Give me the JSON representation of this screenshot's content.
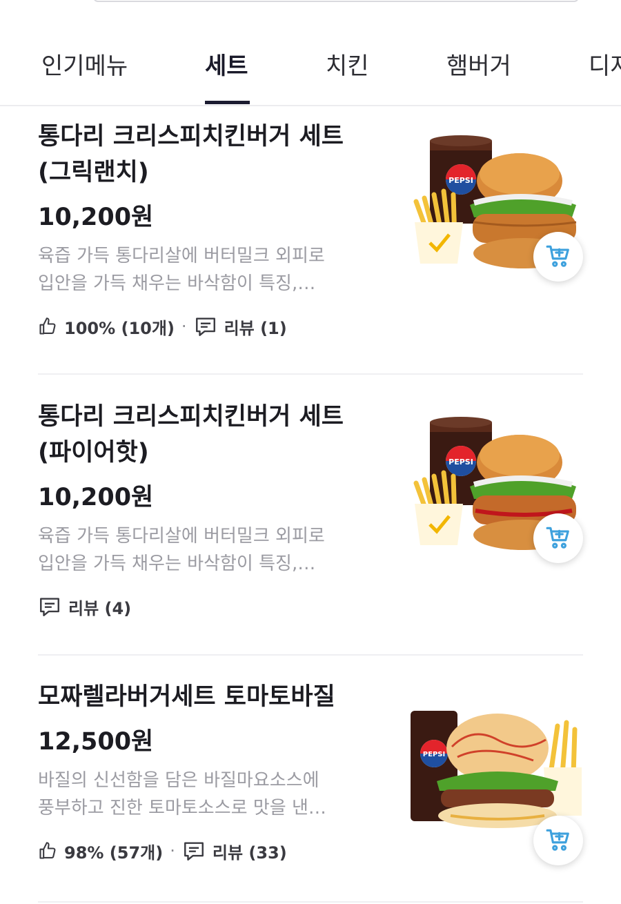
{
  "tabs": [
    {
      "label": "인기메뉴",
      "active": false
    },
    {
      "label": "세트",
      "active": true
    },
    {
      "label": "치킨",
      "active": false
    },
    {
      "label": "햄버거",
      "active": false
    },
    {
      "label": "디저",
      "active": false
    }
  ],
  "items": [
    {
      "title_line1": "통다리 크리스피치킨버거 세트",
      "title_line2": "(그릭랜치)",
      "price": "10,200원",
      "desc_line1": "육즙 가득 통다리살에 버터밀크 외피로",
      "desc_line2": "입안을 가득 채우는 바삭함이 특징,…",
      "like_text": "100% (10개)",
      "review_text": "리뷰 (1)",
      "drink_label": "PEPSI"
    },
    {
      "title_line1": "통다리 크리스피치킨버거 세트",
      "title_line2": "(파이어핫)",
      "price": "10,200원",
      "desc_line1": "육즙 가득 통다리살에 버터밀크 외피로",
      "desc_line2": "입안을 가득 채우는 바삭함이 특징,…",
      "review_text": "리뷰 (4)",
      "drink_label": "PEPSI"
    },
    {
      "title_line1": "모짜렐라버거세트 토마토바질",
      "price": "12,500원",
      "desc_line1": "바질의 신선함을 담은 바질마요소스에",
      "desc_line2": "풍부하고 진한 토마토소스로 맛을 낸…",
      "like_text": "98% (57개)",
      "review_text": "리뷰 (33)",
      "drink_label": "PEPSI"
    }
  ],
  "colors": {
    "accent": "#1b1b30",
    "cart_icon": "#3ea1dd",
    "muted_text": "#9b9ba2"
  },
  "icons": [
    "thumbs-up-icon",
    "review-icon",
    "add-to-cart-icon"
  ]
}
